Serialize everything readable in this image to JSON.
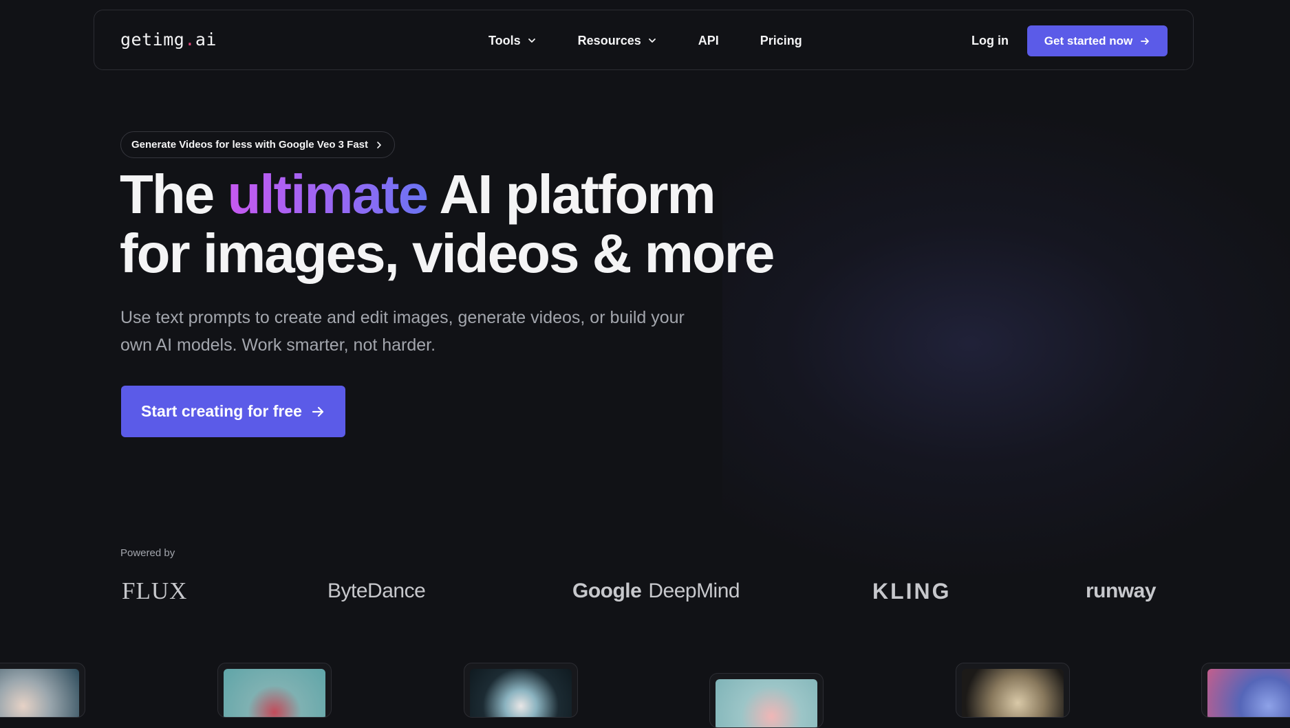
{
  "nav": {
    "logo_main": "getimg",
    "logo_dot": ".",
    "logo_tld": "ai",
    "links": [
      "Tools",
      "Resources",
      "API",
      "Pricing"
    ],
    "login": "Log in",
    "cta": "Get started now"
  },
  "hero": {
    "pill": "Generate Videos for less with Google Veo 3 Fast",
    "headline_pre": "The ",
    "headline_accent": "ultimate",
    "headline_post": " AI platform",
    "headline_line2": "for images, videos & more",
    "subtitle": "Use text prompts to create and edit images, generate videos, or build your own AI models. Work smarter, not harder.",
    "cta": "Start creating for free"
  },
  "powered": {
    "label": "Powered by",
    "brands": [
      "FLUX",
      "ByteDance",
      "Google",
      "DeepMind",
      "KLING",
      "runway"
    ]
  },
  "colors": {
    "background": "#111216",
    "accent_button": "#5b5be8",
    "gradient_start": "#c659f0",
    "gradient_end": "#6a74f2",
    "logo_dot": "#e0457a"
  },
  "icons": [
    "chevron-down-icon",
    "arrow-right-icon",
    "chevron-right-icon"
  ]
}
